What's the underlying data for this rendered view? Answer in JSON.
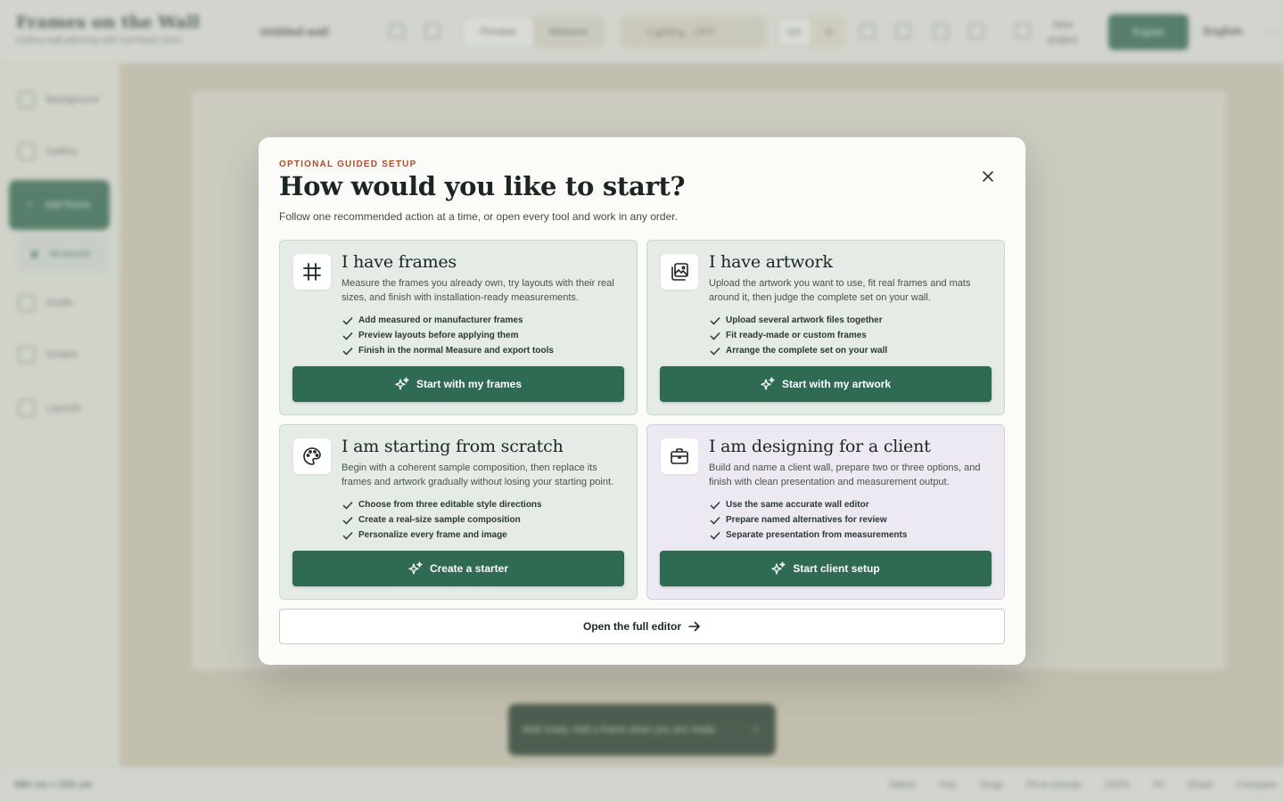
{
  "app": {
    "brand_name": "Frames on the Wall",
    "brand_tagline": "Gallery wall planning with real frame sizes",
    "project_title": "Untitled wall",
    "view_modes": [
      "Preview",
      "Measure"
    ],
    "lighting_label": "Lighting",
    "lighting_value": "OFF",
    "zoom_options": [
      "cm",
      "in"
    ],
    "new_project_label": "New project",
    "export_label": "Export",
    "language_label": "English",
    "sidebar": {
      "items": [
        "Background",
        "Gallery",
        "Add frame",
        "All artwork",
        "Guide",
        "Guides",
        "Layouts"
      ]
    },
    "status_left": "580 cm × 225 cm",
    "status_right": [
      "Select",
      "Pan",
      "Snap",
      "Fit to canvas",
      "100%",
      "Fit",
      "Share",
      "Compare"
    ],
    "toast_text": "Wall ready. Add a frame when you are ready."
  },
  "modal": {
    "eyebrow": "OPTIONAL GUIDED SETUP",
    "title": "How would you like to start?",
    "subtitle": "Follow one recommended action at a time, or open every tool and work in any order.",
    "cards": [
      {
        "icon": "frame-icon",
        "title": "I have frames",
        "description": "Measure the frames you already own, try layouts with their real sizes, and finish with installation-ready measurements.",
        "bullets": [
          "Add measured or manufacturer frames",
          "Preview layouts before applying them",
          "Finish in the normal Measure and export tools"
        ],
        "cta": "Start with my frames"
      },
      {
        "icon": "image-upload-icon",
        "title": "I have artwork",
        "description": "Upload the artwork you want to use, fit real frames and mats around it, then judge the complete set on your wall.",
        "bullets": [
          "Upload several artwork files together",
          "Fit ready-made or custom frames",
          "Arrange the complete set on your wall"
        ],
        "cta": "Start with my artwork"
      },
      {
        "icon": "palette-icon",
        "title": "I am starting from scratch",
        "description": "Begin with a coherent sample composition, then replace its frames and artwork gradually without losing your starting point.",
        "bullets": [
          "Choose from three editable style directions",
          "Create a real-size sample composition",
          "Personalize every frame and image"
        ],
        "cta": "Create a starter"
      },
      {
        "icon": "briefcase-icon",
        "title": "I am designing for a client",
        "description": "Build and name a client wall, prepare two or three options, and finish with clean presentation and measurement output.",
        "bullets": [
          "Use the same accurate wall editor",
          "Prepare named alternatives for review",
          "Separate presentation from measurements"
        ],
        "cta": "Start client setup"
      }
    ],
    "full_editor_label": "Open the full editor"
  },
  "colors": {
    "accent_green": "#2e6b52",
    "eyebrow_red": "#b04a2a",
    "card_green_bg": "#e5ece6",
    "card_lilac_bg": "#ece9f2"
  }
}
